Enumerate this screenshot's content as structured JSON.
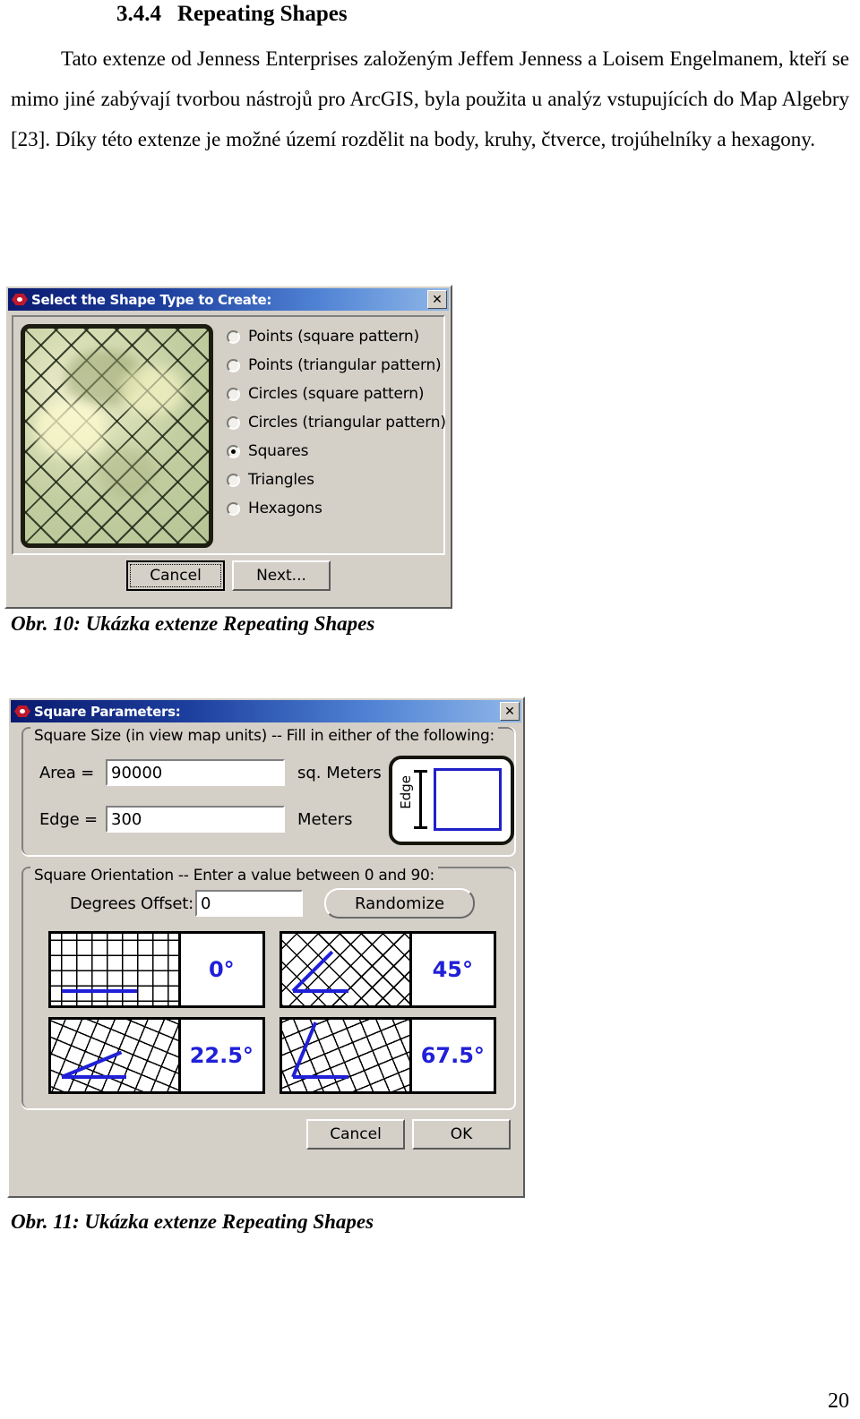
{
  "document": {
    "heading_number": "3.4.4",
    "heading_title": "Repeating Shapes",
    "paragraph": "Tato extenze od Jenness Enterprises založeným Jeffem Jenness a Loisem Engelmanem, kteří se mimo jiné zabývají tvorbou nástrojů pro ArcGIS, byla použita u analýz vstupujících do Map Algebry [23]. Díky této extenze je možné území rozdělit na body, kruhy, čtverce, trojúhelníky a hexagony.",
    "caption_10": "Obr. 10: Ukázka extenze Repeating Shapes",
    "caption_11": "Obr. 11: Ukázka extenze Repeating Shapes",
    "page_number": "20"
  },
  "dialog_shape_type": {
    "title": "Select the Shape Type to Create:",
    "close_label": "✕",
    "options": [
      {
        "label": "Points (square pattern)",
        "selected": false
      },
      {
        "label": "Points (triangular pattern)",
        "selected": false
      },
      {
        "label": "Circles (square pattern)",
        "selected": false
      },
      {
        "label": "Circles (triangular pattern)",
        "selected": false
      },
      {
        "label": "Squares",
        "selected": true
      },
      {
        "label": "Triangles",
        "selected": false
      },
      {
        "label": "Hexagons",
        "selected": false
      }
    ],
    "cancel_label": "Cancel",
    "next_label": "Next..."
  },
  "dialog_square_params": {
    "title": "Square Parameters:",
    "close_label": "✕",
    "group_size_title": "Square Size (in view map units)  --  Fill in either of the following:",
    "area_label": "Area =",
    "area_value": "90000",
    "area_unit": "sq. Meters",
    "edge_label": "Edge =",
    "edge_value": "300",
    "edge_unit": "Meters",
    "edge_illustration_label": "Edge",
    "group_orientation_title": "Square Orientation  --  Enter a value between 0 and 90:",
    "degrees_label": "Degrees Offset:",
    "degrees_value": "0",
    "randomize_label": "Randomize",
    "angle_samples": [
      {
        "value": "0°",
        "angle": 0
      },
      {
        "value": "45°",
        "angle": 45
      },
      {
        "value": "22.5°",
        "angle": 22.5
      },
      {
        "value": "67.5°",
        "angle": 67.5
      }
    ],
    "cancel_label": "Cancel",
    "ok_label": "OK"
  },
  "colors": {
    "dialog_face": "#d4d0c8",
    "titlebar_start": "#0a1a6e",
    "titlebar_end": "#8fb7e8",
    "accent_blue": "#2020d8",
    "icon_red": "#c0182c"
  }
}
